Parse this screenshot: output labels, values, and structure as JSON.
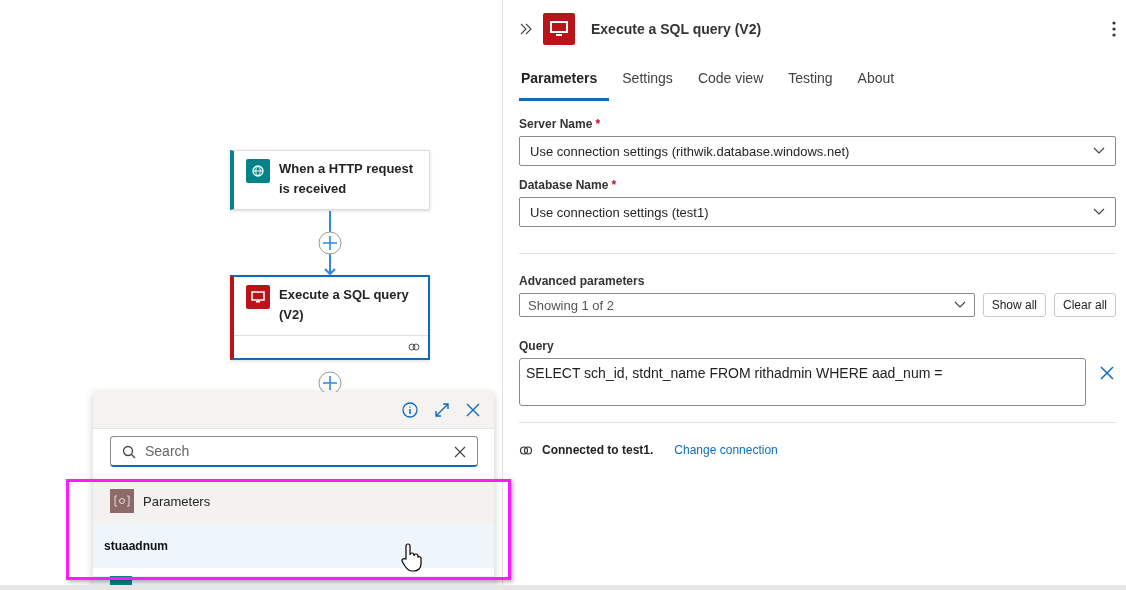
{
  "canvas": {
    "nodes": [
      {
        "title": "When a HTTP request is received",
        "kind": "http",
        "color": "#038387",
        "selected": false
      },
      {
        "title": "Execute a SQL query (V2)",
        "kind": "sql",
        "color": "#ba141a",
        "selected": true
      }
    ],
    "popup": {
      "search": {
        "placeholder": "Search"
      },
      "section": "Parameters",
      "items": [
        {
          "label": "stuaadnum",
          "selected": true
        }
      ]
    }
  },
  "panel": {
    "title": "Execute a SQL query (V2)",
    "tabs": [
      {
        "label": "Parameters",
        "selected": true
      },
      {
        "label": "Settings",
        "selected": false
      },
      {
        "label": "Code view",
        "selected": false
      },
      {
        "label": "Testing",
        "selected": false
      },
      {
        "label": "About",
        "selected": false
      }
    ],
    "fields": [
      {
        "label": "Server Name",
        "required_mark": "*",
        "value": "Use connection settings (rithwik.database.windows.net)"
      },
      {
        "label": "Database Name",
        "required_mark": "*",
        "value": "Use connection settings (test1)"
      }
    ],
    "advanced": {
      "label": "Advanced parameters",
      "value": "Showing 1 of 2",
      "buttons": [
        "Show all",
        "Clear all"
      ]
    },
    "query": {
      "label": "Query",
      "value": "SELECT sch_id, stdnt_name FROM rithadmin WHERE aad_num ="
    },
    "connection": {
      "text": "Connected to test1.",
      "link": "Change connection"
    }
  }
}
